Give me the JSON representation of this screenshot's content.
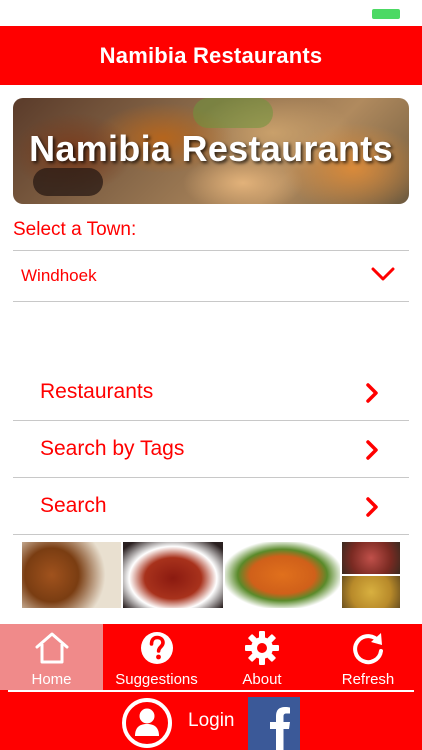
{
  "header": {
    "title": "Namibia Restaurants"
  },
  "banner": {
    "title": "Namibia Restaurants"
  },
  "town_selector": {
    "label": "Select a Town:",
    "selected": "Windhoek"
  },
  "menu": {
    "items": [
      {
        "label": "Restaurants"
      },
      {
        "label": "Search by Tags"
      },
      {
        "label": "Search"
      }
    ]
  },
  "tabs": [
    {
      "label": "Home",
      "icon": "home-icon",
      "active": true
    },
    {
      "label": "Suggestions",
      "icon": "question-icon",
      "active": false
    },
    {
      "label": "About",
      "icon": "gear-icon",
      "active": false
    },
    {
      "label": "Refresh",
      "icon": "refresh-icon",
      "active": false
    }
  ],
  "footer": {
    "login_label": "Login",
    "facebook_icon": "facebook-icon"
  },
  "colors": {
    "accent": "#ff0000",
    "active_tab": "#f08a8a",
    "facebook": "#3b5998",
    "battery": "#4cd964"
  }
}
